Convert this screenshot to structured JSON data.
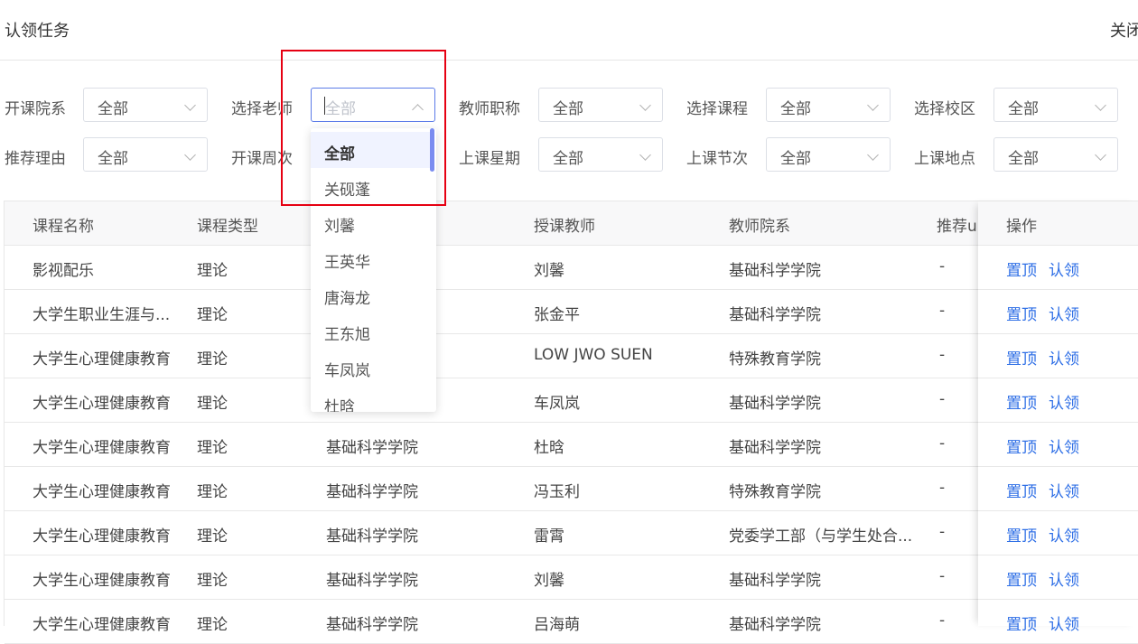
{
  "header": {
    "title": "认领任务",
    "close_label": "关闭"
  },
  "filters": [
    {
      "label": "开课院系",
      "value": "全部"
    },
    {
      "label": "选择老师",
      "value": "",
      "placeholder": "全部",
      "open": true
    },
    {
      "label": "教师职称",
      "value": "全部"
    },
    {
      "label": "选择课程",
      "value": "全部"
    },
    {
      "label": "选择校区",
      "value": "全部"
    },
    {
      "label": "推荐理由",
      "value": "全部"
    },
    {
      "label": "开课周次",
      "value": ""
    },
    {
      "label": "上课星期",
      "value": "全部"
    },
    {
      "label": "上课节次",
      "value": "全部"
    },
    {
      "label": "上课地点",
      "value": "全部"
    }
  ],
  "teacher_dropdown": {
    "options": [
      "全部",
      "关砚蓬",
      "刘馨",
      "王英华",
      "唐海龙",
      "王东旭",
      "车凤岚",
      "杜晗"
    ],
    "selected": "全部"
  },
  "table": {
    "columns": [
      "课程名称",
      "课程类型",
      "",
      "授课教师",
      "教师院系",
      "推荐u",
      "操作"
    ],
    "rows": [
      [
        "影视配乐",
        "理论",
        "",
        "刘馨",
        "基础科学学院",
        "-"
      ],
      [
        "大学生职业生涯与...",
        "理论",
        "",
        "张金平",
        "基础科学学院",
        "-"
      ],
      [
        "大学生心理健康教育",
        "理论",
        "",
        "LOW JWO SUEN",
        "特殊教育学院",
        "-"
      ],
      [
        "大学生心理健康教育",
        "理论",
        "",
        "车凤岚",
        "基础科学学院",
        "-"
      ],
      [
        "大学生心理健康教育",
        "理论",
        "基础科学学院",
        "杜晗",
        "基础科学学院",
        "-"
      ],
      [
        "大学生心理健康教育",
        "理论",
        "基础科学学院",
        "冯玉利",
        "特殊教育学院",
        "-"
      ],
      [
        "大学生心理健康教育",
        "理论",
        "基础科学学院",
        "雷霄",
        "党委学工部（与学生处合...",
        "-"
      ],
      [
        "大学生心理健康教育",
        "理论",
        "基础科学学院",
        "刘馨",
        "基础科学学院",
        "-"
      ],
      [
        "大学生心理健康教育",
        "理论",
        "基础科学学院",
        "吕海萌",
        "基础科学学院",
        "-"
      ]
    ],
    "actions": {
      "pin": "置顶",
      "claim": "认领"
    }
  },
  "colors": {
    "link": "#2d6ee6",
    "highlight": "#e60012",
    "selected_bg": "#f0f3ff"
  }
}
